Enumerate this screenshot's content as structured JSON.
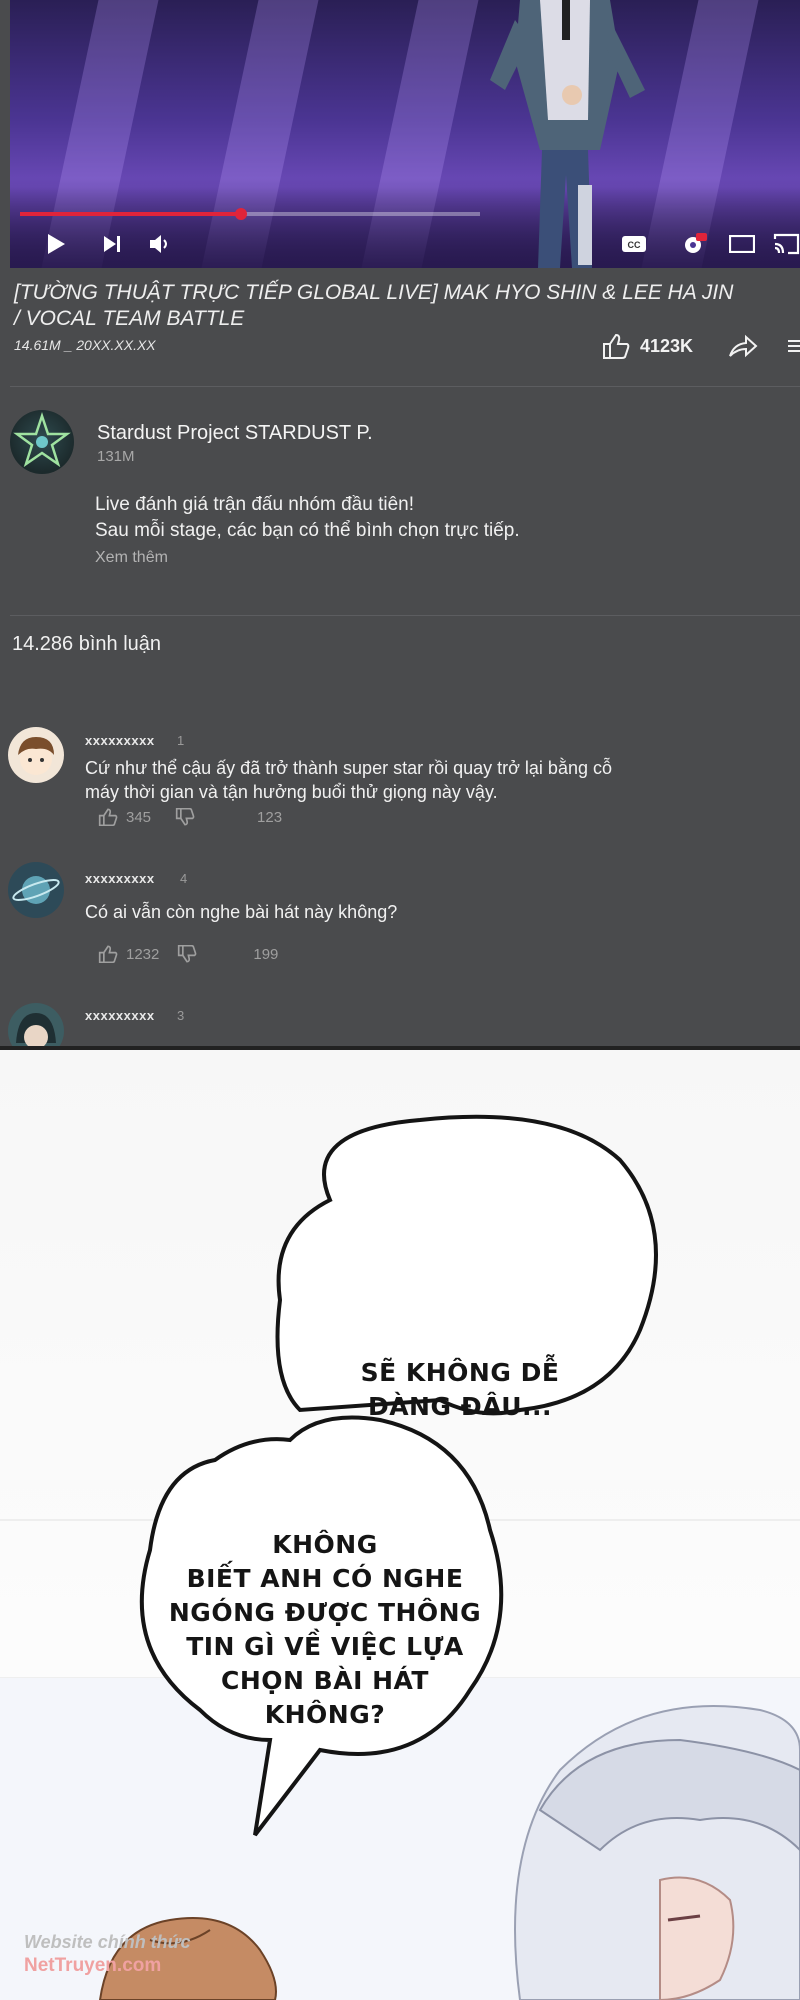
{
  "video": {
    "title": "[TƯỜNG THUẬT TRỰC TIẾP GLOBAL LIVE] MAK HYO SHIN & LEE HA JIN / VOCAL TEAM BATTLE",
    "meta": "14.61M _ 20XX.XX.XX",
    "progress_fraction": 0.48,
    "likes": "4123K"
  },
  "channel": {
    "name": "Stardust Project STARDUST P.",
    "subscribers": "131M",
    "description_line1": "Live đánh giá trận đấu nhóm đầu tiên!",
    "description_line2": "Sau mỗi stage, các bạn có thể bình chọn trực tiếp.",
    "show_more": "Xem thêm"
  },
  "comments_header": "14.286 bình luận",
  "comments": [
    {
      "user": "xxxxxxxxx",
      "time": "1",
      "text_line1": "Cứ như thể cậu ấy đã trở thành super star rồi quay trở lại bằng cỗ",
      "text_line2": "máy thời gian và tận hưởng buổi thử giọng này vậy.",
      "likes": "345",
      "replies": "123"
    },
    {
      "user": "xxxxxxxxx",
      "time": "4",
      "text_line1": "Có ai vẫn còn nghe bài hát này không?",
      "likes": "1232",
      "replies": "199"
    },
    {
      "user": "xxxxxxxxx",
      "time": "3"
    }
  ],
  "comic": {
    "bubble1_line1": "SẼ KHÔNG DỄ",
    "bubble1_line2": "DÀNG ĐÂU...",
    "bubble2_lines": [
      "KHÔNG",
      "BIẾT ANH CÓ NGHE",
      "NGÓNG ĐƯỢC THÔNG",
      "TIN GÌ VỀ VIỆC LỰA",
      "CHỌN BÀI HÁT",
      "KHÔNG?"
    ]
  },
  "watermark": {
    "line1": "Website chính thức",
    "line2": "NetTruyen.com"
  },
  "colors": {
    "progress": "#e0243a",
    "panel_bg": "#4a4b4d",
    "watermark_red": "#f0a1a1"
  },
  "icons": [
    "play-icon",
    "next-icon",
    "volume-icon",
    "captions-icon",
    "settings-icon",
    "miniplayer-icon",
    "cast-icon",
    "like-icon",
    "share-icon",
    "menu-icon",
    "dislike-icon"
  ]
}
